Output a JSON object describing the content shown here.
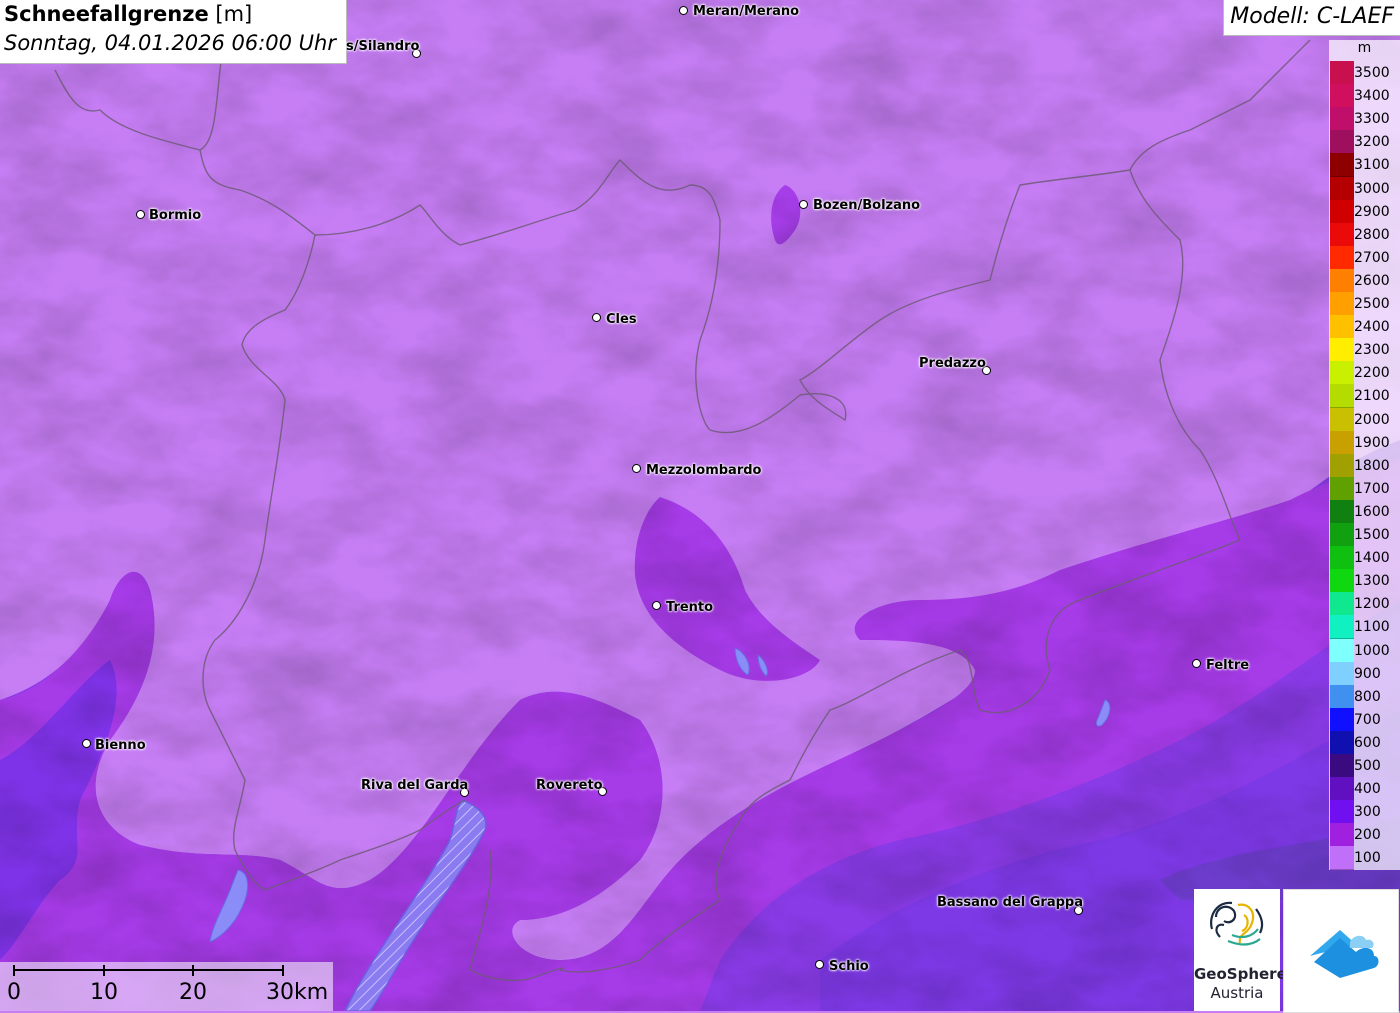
{
  "title": {
    "main": "Schneefallgrenze",
    "unit": "[m]",
    "date": "Sonntag, 04.01.2026 06:00 Uhr"
  },
  "model": {
    "label": "Modell: C-LAEF"
  },
  "legend": {
    "unit": "m",
    "items": [
      {
        "label": "3500",
        "color": "#c8104e"
      },
      {
        "label": "3400",
        "color": "#d00f5e"
      },
      {
        "label": "3300",
        "color": "#c00f6a"
      },
      {
        "label": "3200",
        "color": "#9e0f5e"
      },
      {
        "label": "3100",
        "color": "#8e0000"
      },
      {
        "label": "3000",
        "color": "#b40000"
      },
      {
        "label": "2900",
        "color": "#d00000"
      },
      {
        "label": "2800",
        "color": "#ea0a0a"
      },
      {
        "label": "2700",
        "color": "#ff2a00"
      },
      {
        "label": "2600",
        "color": "#ff8000"
      },
      {
        "label": "2500",
        "color": "#ffa000"
      },
      {
        "label": "2400",
        "color": "#ffc000"
      },
      {
        "label": "2300",
        "color": "#ffee00"
      },
      {
        "label": "2200",
        "color": "#c8f000"
      },
      {
        "label": "2100",
        "color": "#b4dc00"
      },
      {
        "label": "2000",
        "color": "#c8c000"
      },
      {
        "label": "1900",
        "color": "#c8a000"
      },
      {
        "label": "1800",
        "color": "#a0a000"
      },
      {
        "label": "1700",
        "color": "#60a000"
      },
      {
        "label": "1600",
        "color": "#108010"
      },
      {
        "label": "1500",
        "color": "#10a010"
      },
      {
        "label": "1400",
        "color": "#10c010"
      },
      {
        "label": "1300",
        "color": "#10d810"
      },
      {
        "label": "1200",
        "color": "#10e890"
      },
      {
        "label": "1100",
        "color": "#10f0c0"
      },
      {
        "label": "1000",
        "color": "#80ffff"
      },
      {
        "label": "900",
        "color": "#80d0ff"
      },
      {
        "label": "800",
        "color": "#4090f0"
      },
      {
        "label": "700",
        "color": "#1010ff"
      },
      {
        "label": "600",
        "color": "#1010b0"
      },
      {
        "label": "500",
        "color": "#3a0a80"
      },
      {
        "label": "400",
        "color": "#6010c0"
      },
      {
        "label": "300",
        "color": "#7010f0"
      },
      {
        "label": "200",
        "color": "#a020e0"
      },
      {
        "label": "100",
        "color": "#c070f8"
      }
    ]
  },
  "cities": [
    {
      "name": "Meran/Merano"
    },
    {
      "name": "s/Silandro"
    },
    {
      "name": "Bormio"
    },
    {
      "name": "Bozen/Bolzano"
    },
    {
      "name": "Cles"
    },
    {
      "name": "Predazzo"
    },
    {
      "name": "Mezzolombardo"
    },
    {
      "name": "Trento"
    },
    {
      "name": "Feltre"
    },
    {
      "name": "Bienno"
    },
    {
      "name": "Riva del Garda"
    },
    {
      "name": "Rovereto"
    },
    {
      "name": "Bassano del Grappa"
    },
    {
      "name": "Schio"
    }
  ],
  "scale": {
    "labels": [
      "0",
      "10",
      "20",
      "30km"
    ]
  },
  "logos": {
    "geosphere_line1": "GeoSphere",
    "geosphere_line2": "Austria",
    "icon": "cloud-house-icon"
  }
}
